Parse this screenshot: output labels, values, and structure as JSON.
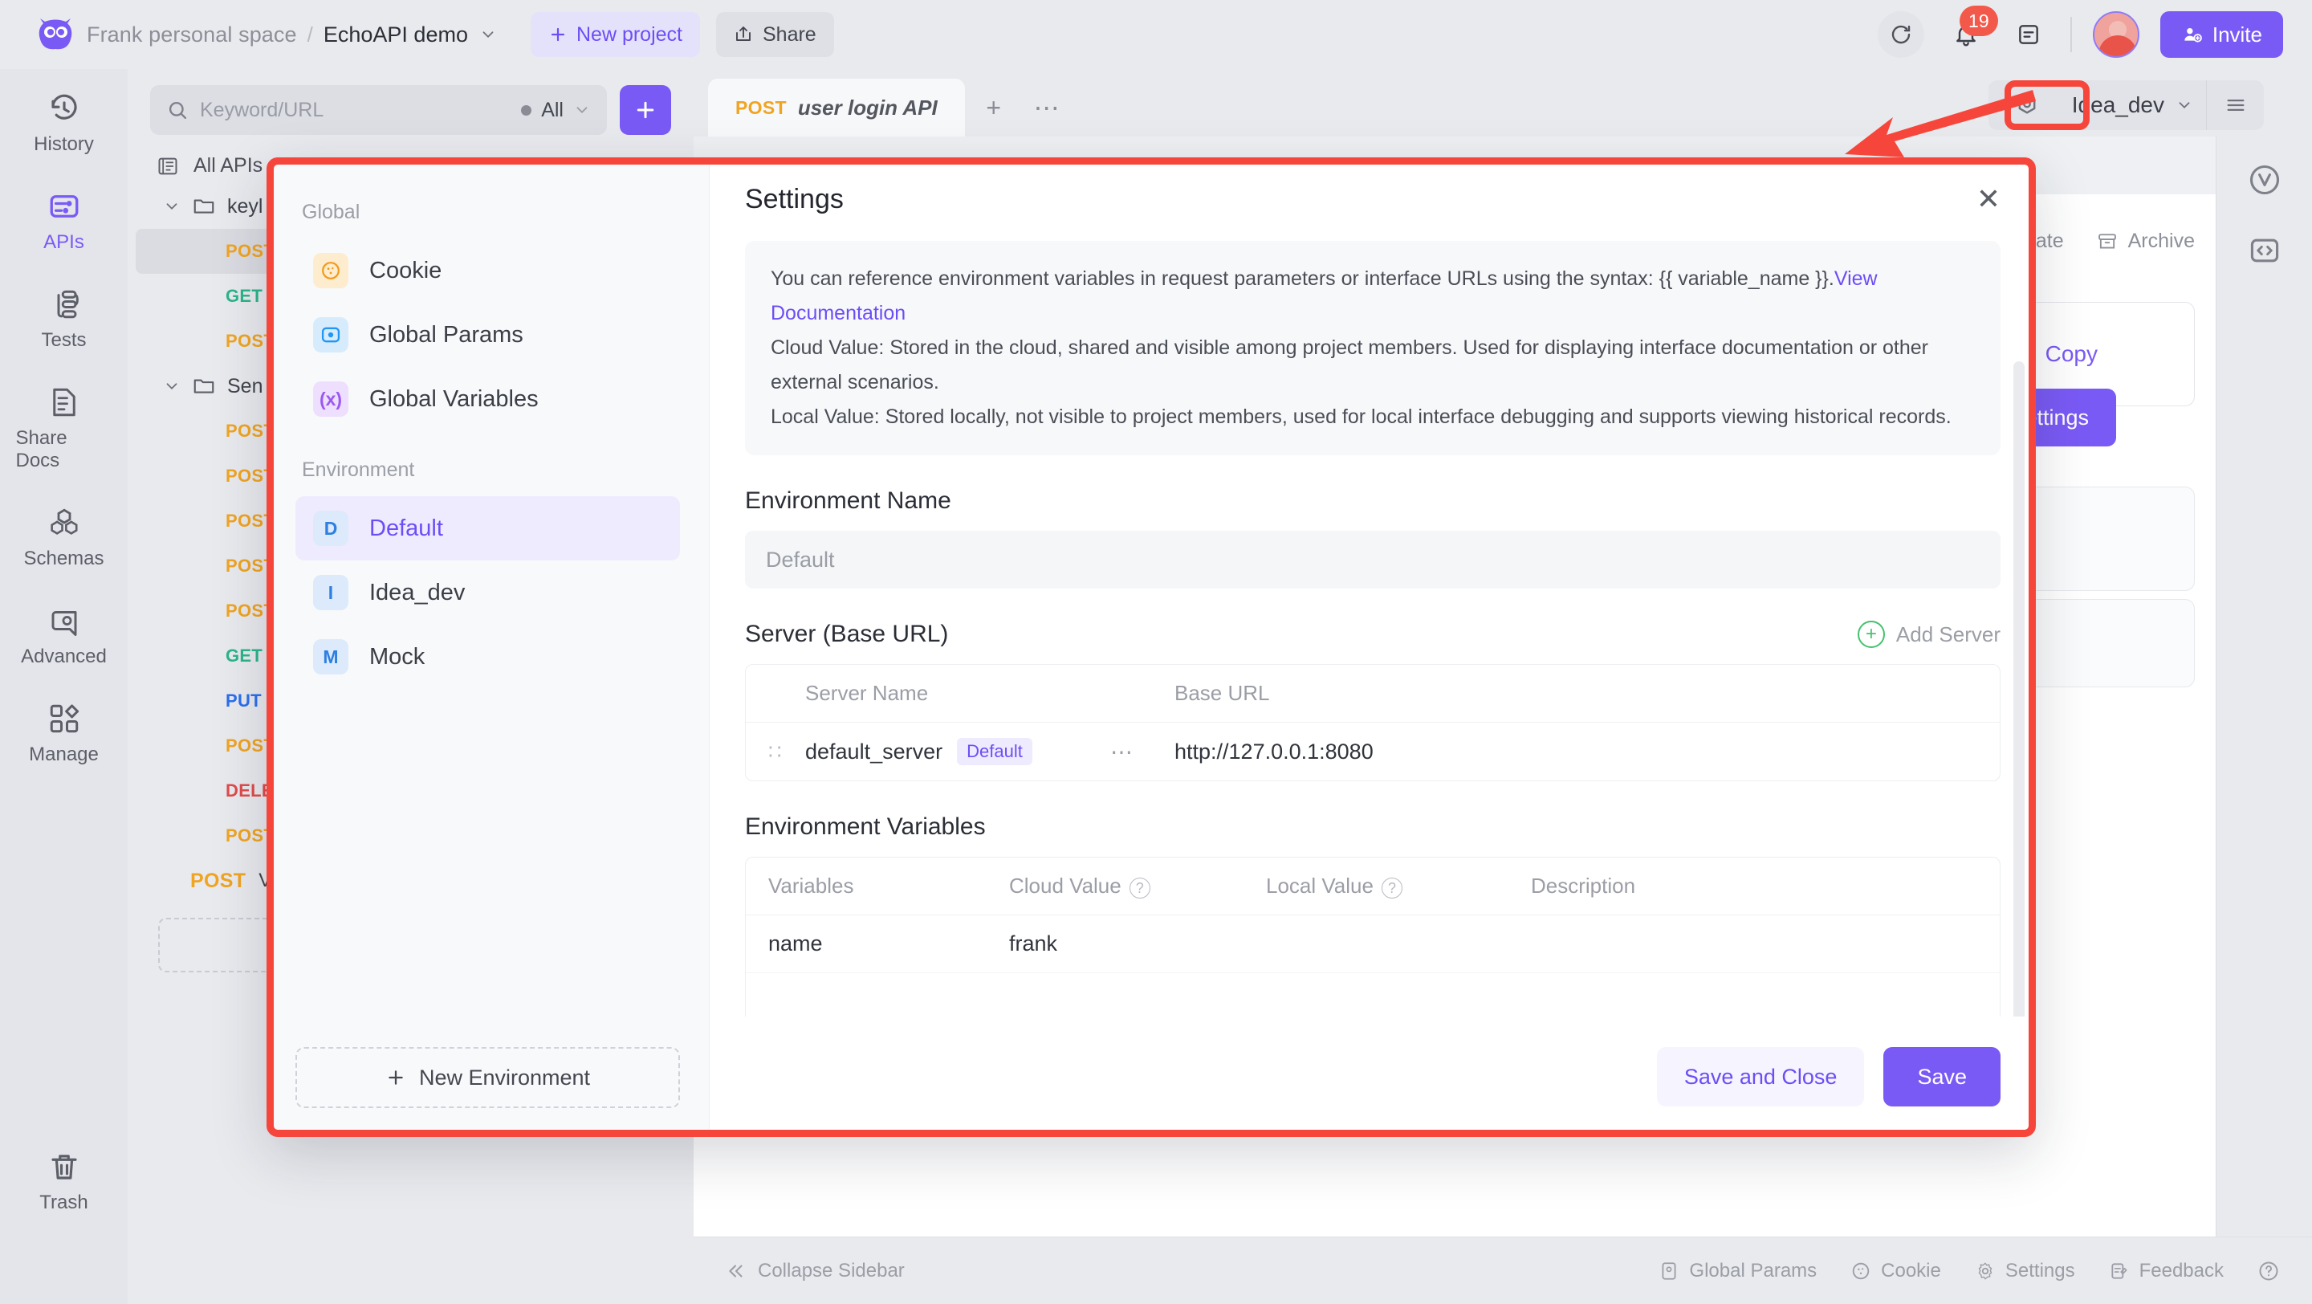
{
  "topbar": {
    "workspace": "Frank personal space",
    "separator": "/",
    "project": "EchoAPI demo",
    "new_project": "New project",
    "share": "Share",
    "notification_count": "19",
    "invite": "Invite"
  },
  "rail": {
    "items": [
      {
        "label": "History",
        "icon": "history-icon",
        "active": false
      },
      {
        "label": "APIs",
        "icon": "sliders-icon",
        "active": true
      },
      {
        "label": "Tests",
        "icon": "tests-flow-icon",
        "active": false
      },
      {
        "label": "Share Docs",
        "icon": "share-docs-icon",
        "active": false
      },
      {
        "label": "Schemas",
        "icon": "schemas-icon",
        "active": false
      },
      {
        "label": "Advanced",
        "icon": "advanced-eye-icon",
        "active": false
      },
      {
        "label": "Manage",
        "icon": "manage-grid-icon",
        "active": false
      }
    ],
    "trash": "Trash"
  },
  "list_panel": {
    "search_placeholder": "Keyword/URL",
    "filter_label": "All",
    "add_button": "+",
    "all_apis": "All APIs",
    "folders": [
      {
        "name": "keyl",
        "items": [
          {
            "method": "POST",
            "name": "",
            "selected": true
          },
          {
            "method": "GET",
            "name": "",
            "selected": false
          },
          {
            "method": "POST",
            "name": "",
            "selected": false
          }
        ]
      },
      {
        "name": "Sen",
        "items": [
          {
            "method": "POST",
            "name": "",
            "selected": false
          },
          {
            "method": "POST",
            "name": "",
            "selected": false
          },
          {
            "method": "POST",
            "name": "",
            "selected": false
          },
          {
            "method": "POST",
            "name": "",
            "selected": false
          },
          {
            "method": "POST",
            "name": "",
            "selected": false
          },
          {
            "method": "GET",
            "name": "",
            "selected": false
          },
          {
            "method": "PUT",
            "name": "",
            "selected": false
          },
          {
            "method": "POST",
            "name": "",
            "selected": false
          },
          {
            "method": "DELETE",
            "name": "",
            "selected": false
          },
          {
            "method": "POST",
            "name": "",
            "selected": false
          }
        ]
      }
    ],
    "last_item": {
      "method": "POST",
      "name": "V"
    }
  },
  "tabs": {
    "active": {
      "method": "POST",
      "name": "user login API"
    },
    "add": "+",
    "more": "⋯"
  },
  "main_panel": {
    "duplicate": "uplicate",
    "archive": "Archive",
    "copy_label": "Copy",
    "save_settings": "Save Settings",
    "env_name": "Idea_dev"
  },
  "footer": {
    "collapse": "Collapse Sidebar",
    "items": [
      {
        "label": "Global Params",
        "icon": "global-params-icon"
      },
      {
        "label": "Cookie",
        "icon": "cookie-icon"
      },
      {
        "label": "Settings",
        "icon": "gear-icon"
      },
      {
        "label": "Feedback",
        "icon": "feedback-icon"
      }
    ],
    "help": "?"
  },
  "modal": {
    "title": "Settings",
    "close": "✕",
    "group_global_label": "Global",
    "group_env_label": "Environment",
    "global_items": [
      {
        "label": "Cookie",
        "badge": "",
        "icon": "cookie-icon",
        "active": false
      },
      {
        "label": "Global Params",
        "badge": "",
        "icon": "global-params-icon",
        "active": false
      },
      {
        "label": "Global Variables",
        "badge": "(x)",
        "icon": "global-variables-icon",
        "active": false
      }
    ],
    "env_items": [
      {
        "label": "Default",
        "badge": "D",
        "active": true
      },
      {
        "label": "Idea_dev",
        "badge": "I",
        "active": false
      },
      {
        "label": "Mock",
        "badge": "M",
        "active": false
      }
    ],
    "new_environment": "New Environment",
    "notice": {
      "line1_pre": "You can reference environment variables in request parameters or interface URLs using the syntax: {{ variable_name }}.",
      "link": "View Documentation",
      "line2": "Cloud Value: Stored in the cloud, shared and visible among project members. Used for displaying interface documentation or other external scenarios.",
      "line3": "Local Value: Stored locally, not visible to project members, used for local interface debugging and supports viewing historical records."
    },
    "env_name_section": {
      "title": "Environment Name",
      "value": "",
      "placeholder": "Default"
    },
    "server_section": {
      "title": "Server (Base URL)",
      "add_server": "Add Server",
      "columns": [
        "Server Name",
        "Base URL"
      ],
      "rows": [
        {
          "drag": "∷",
          "name": "default_server",
          "badge": "Default",
          "dots": "⋯",
          "url": "http://127.0.0.1:8080"
        }
      ]
    },
    "variables_section": {
      "title": "Environment Variables",
      "columns": [
        "Variables",
        "Cloud Value",
        "Local Value",
        "Description"
      ],
      "rows": [
        {
          "variable": "name",
          "cloud": "frank",
          "local": "",
          "description": ""
        },
        {
          "variable": "",
          "cloud": "",
          "local": "",
          "description": ""
        }
      ]
    },
    "save_and_close": "Save and Close",
    "save": "Save"
  },
  "colors": {
    "accent": "#7a5af5",
    "annotation": "#f6463b",
    "method_post": "#f0a422",
    "method_get": "#2cb589",
    "method_put": "#2a6ff0",
    "method_delete": "#e14b4b"
  }
}
